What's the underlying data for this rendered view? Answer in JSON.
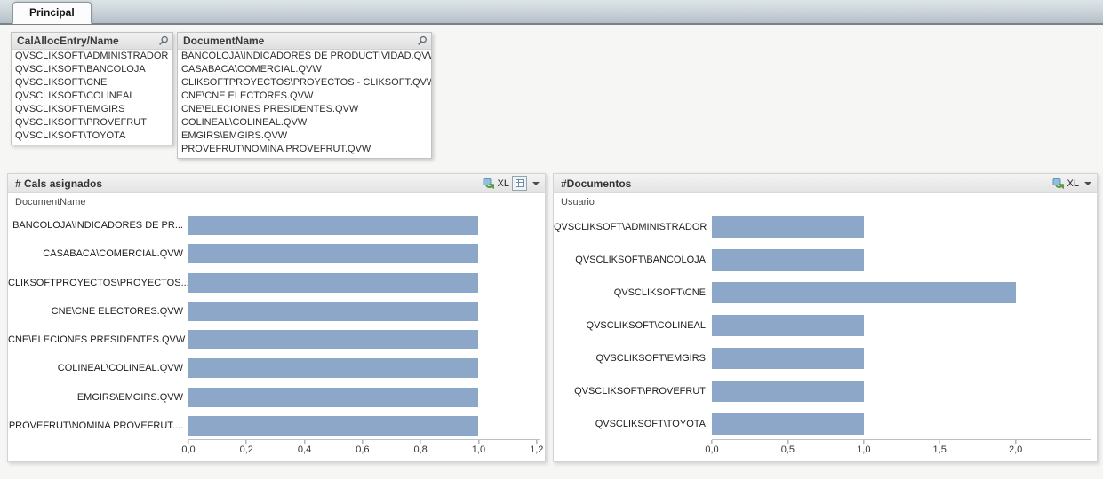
{
  "tab_bar": {
    "tabs": [
      {
        "label": "Principal",
        "active": true
      }
    ]
  },
  "listboxes": [
    {
      "title": "CalAllocEntry/Name",
      "items": [
        "QVSCLIKSOFT\\ADMINISTRADOR",
        "QVSCLIKSOFT\\BANCOLOJA",
        "QVSCLIKSOFT\\CNE",
        "QVSCLIKSOFT\\COLINEAL",
        "QVSCLIKSOFT\\EMGIRS",
        "QVSCLIKSOFT\\PROVEFRUT",
        "QVSCLIKSOFT\\TOYOTA"
      ]
    },
    {
      "title": "DocumentName",
      "items": [
        "BANCOLOJA\\INDICADORES DE PRODUCTIVIDAD.QVW",
        "CASABACA\\COMERCIAL.QVW",
        "CLIKSOFTPROYECTOS\\PROYECTOS - CLIKSOFT.QVW",
        "CNE\\CNE ELECTORES.QVW",
        "CNE\\ELECIONES PRESIDENTES.QVW",
        "COLINEAL\\COLINEAL.QVW",
        "EMGIRS\\EMGIRS.QVW",
        "PROVEFRUT\\NOMINA PROVEFRUT.QVW"
      ]
    }
  ],
  "charts": [
    {
      "title": "# Cals asignados",
      "dimension_label": "DocumentName",
      "toolbar": {
        "xl_label": "XL"
      }
    },
    {
      "title": "#Documentos",
      "dimension_label": "Usuario",
      "toolbar": {
        "xl_label": "XL"
      }
    }
  ],
  "chart_data": [
    {
      "type": "bar",
      "orientation": "horizontal",
      "title": "# Cals asignados",
      "xlabel": "",
      "ylabel": "DocumentName",
      "categories": [
        "BANCOLOJA\\INDICADORES DE PR...",
        "CASABACA\\COMERCIAL.QVW",
        "CLIKSOFTPROYECTOS\\PROYECTOS...",
        "CNE\\CNE ELECTORES.QVW",
        "CNE\\ELECIONES PRESIDENTES.QVW",
        "COLINEAL\\COLINEAL.QVW",
        "EMGIRS\\EMGIRS.QVW",
        "PROVEFRUT\\NOMINA PROVEFRUT...."
      ],
      "values": [
        1.0,
        1.0,
        1.0,
        1.0,
        1.0,
        1.0,
        1.0,
        1.0
      ],
      "xlim": [
        0,
        1.21
      ],
      "ticks": [
        0,
        0.2,
        0.4,
        0.6,
        0.8,
        1.0,
        1.2
      ],
      "tick_labels": [
        "0,0",
        "0,2",
        "0,4",
        "0,6",
        "0,8",
        "1,0",
        "1,2"
      ],
      "grid": false,
      "bar_color": "#8CA7C7"
    },
    {
      "type": "bar",
      "orientation": "horizontal",
      "title": "#Documentos",
      "xlabel": "",
      "ylabel": "Usuario",
      "categories": [
        "QVSCLIKSOFT\\ADMINISTRADOR",
        "QVSCLIKSOFT\\BANCOLOJA",
        "QVSCLIKSOFT\\CNE",
        "QVSCLIKSOFT\\COLINEAL",
        "QVSCLIKSOFT\\EMGIRS",
        "QVSCLIKSOFT\\PROVEFRUT",
        "QVSCLIKSOFT\\TOYOTA"
      ],
      "values": [
        1.0,
        1.0,
        2.0,
        1.0,
        1.0,
        1.0,
        1.0
      ],
      "xlim": [
        0,
        2.5
      ],
      "ticks": [
        0,
        0.5,
        1.0,
        1.5,
        2.0
      ],
      "tick_labels": [
        "0,0",
        "0,5",
        "1,0",
        "1,5",
        "2,0"
      ],
      "grid": false,
      "bar_color": "#8CA7C7"
    }
  ],
  "icons": {
    "search": "magnifier-icon",
    "xl_export": "excel-export-icon",
    "fast_change": "fast-type-change-icon",
    "menu": "chevron-down-icon"
  },
  "colors": {
    "bar": "#8CA7C7",
    "axis_line": "#b5c2cc",
    "caption_bg": "#e8e8e8",
    "tabbar_top": "#dde4e8",
    "tabbar_bottom": "#b4bfc6",
    "page_bg": "#f6f6f5"
  }
}
